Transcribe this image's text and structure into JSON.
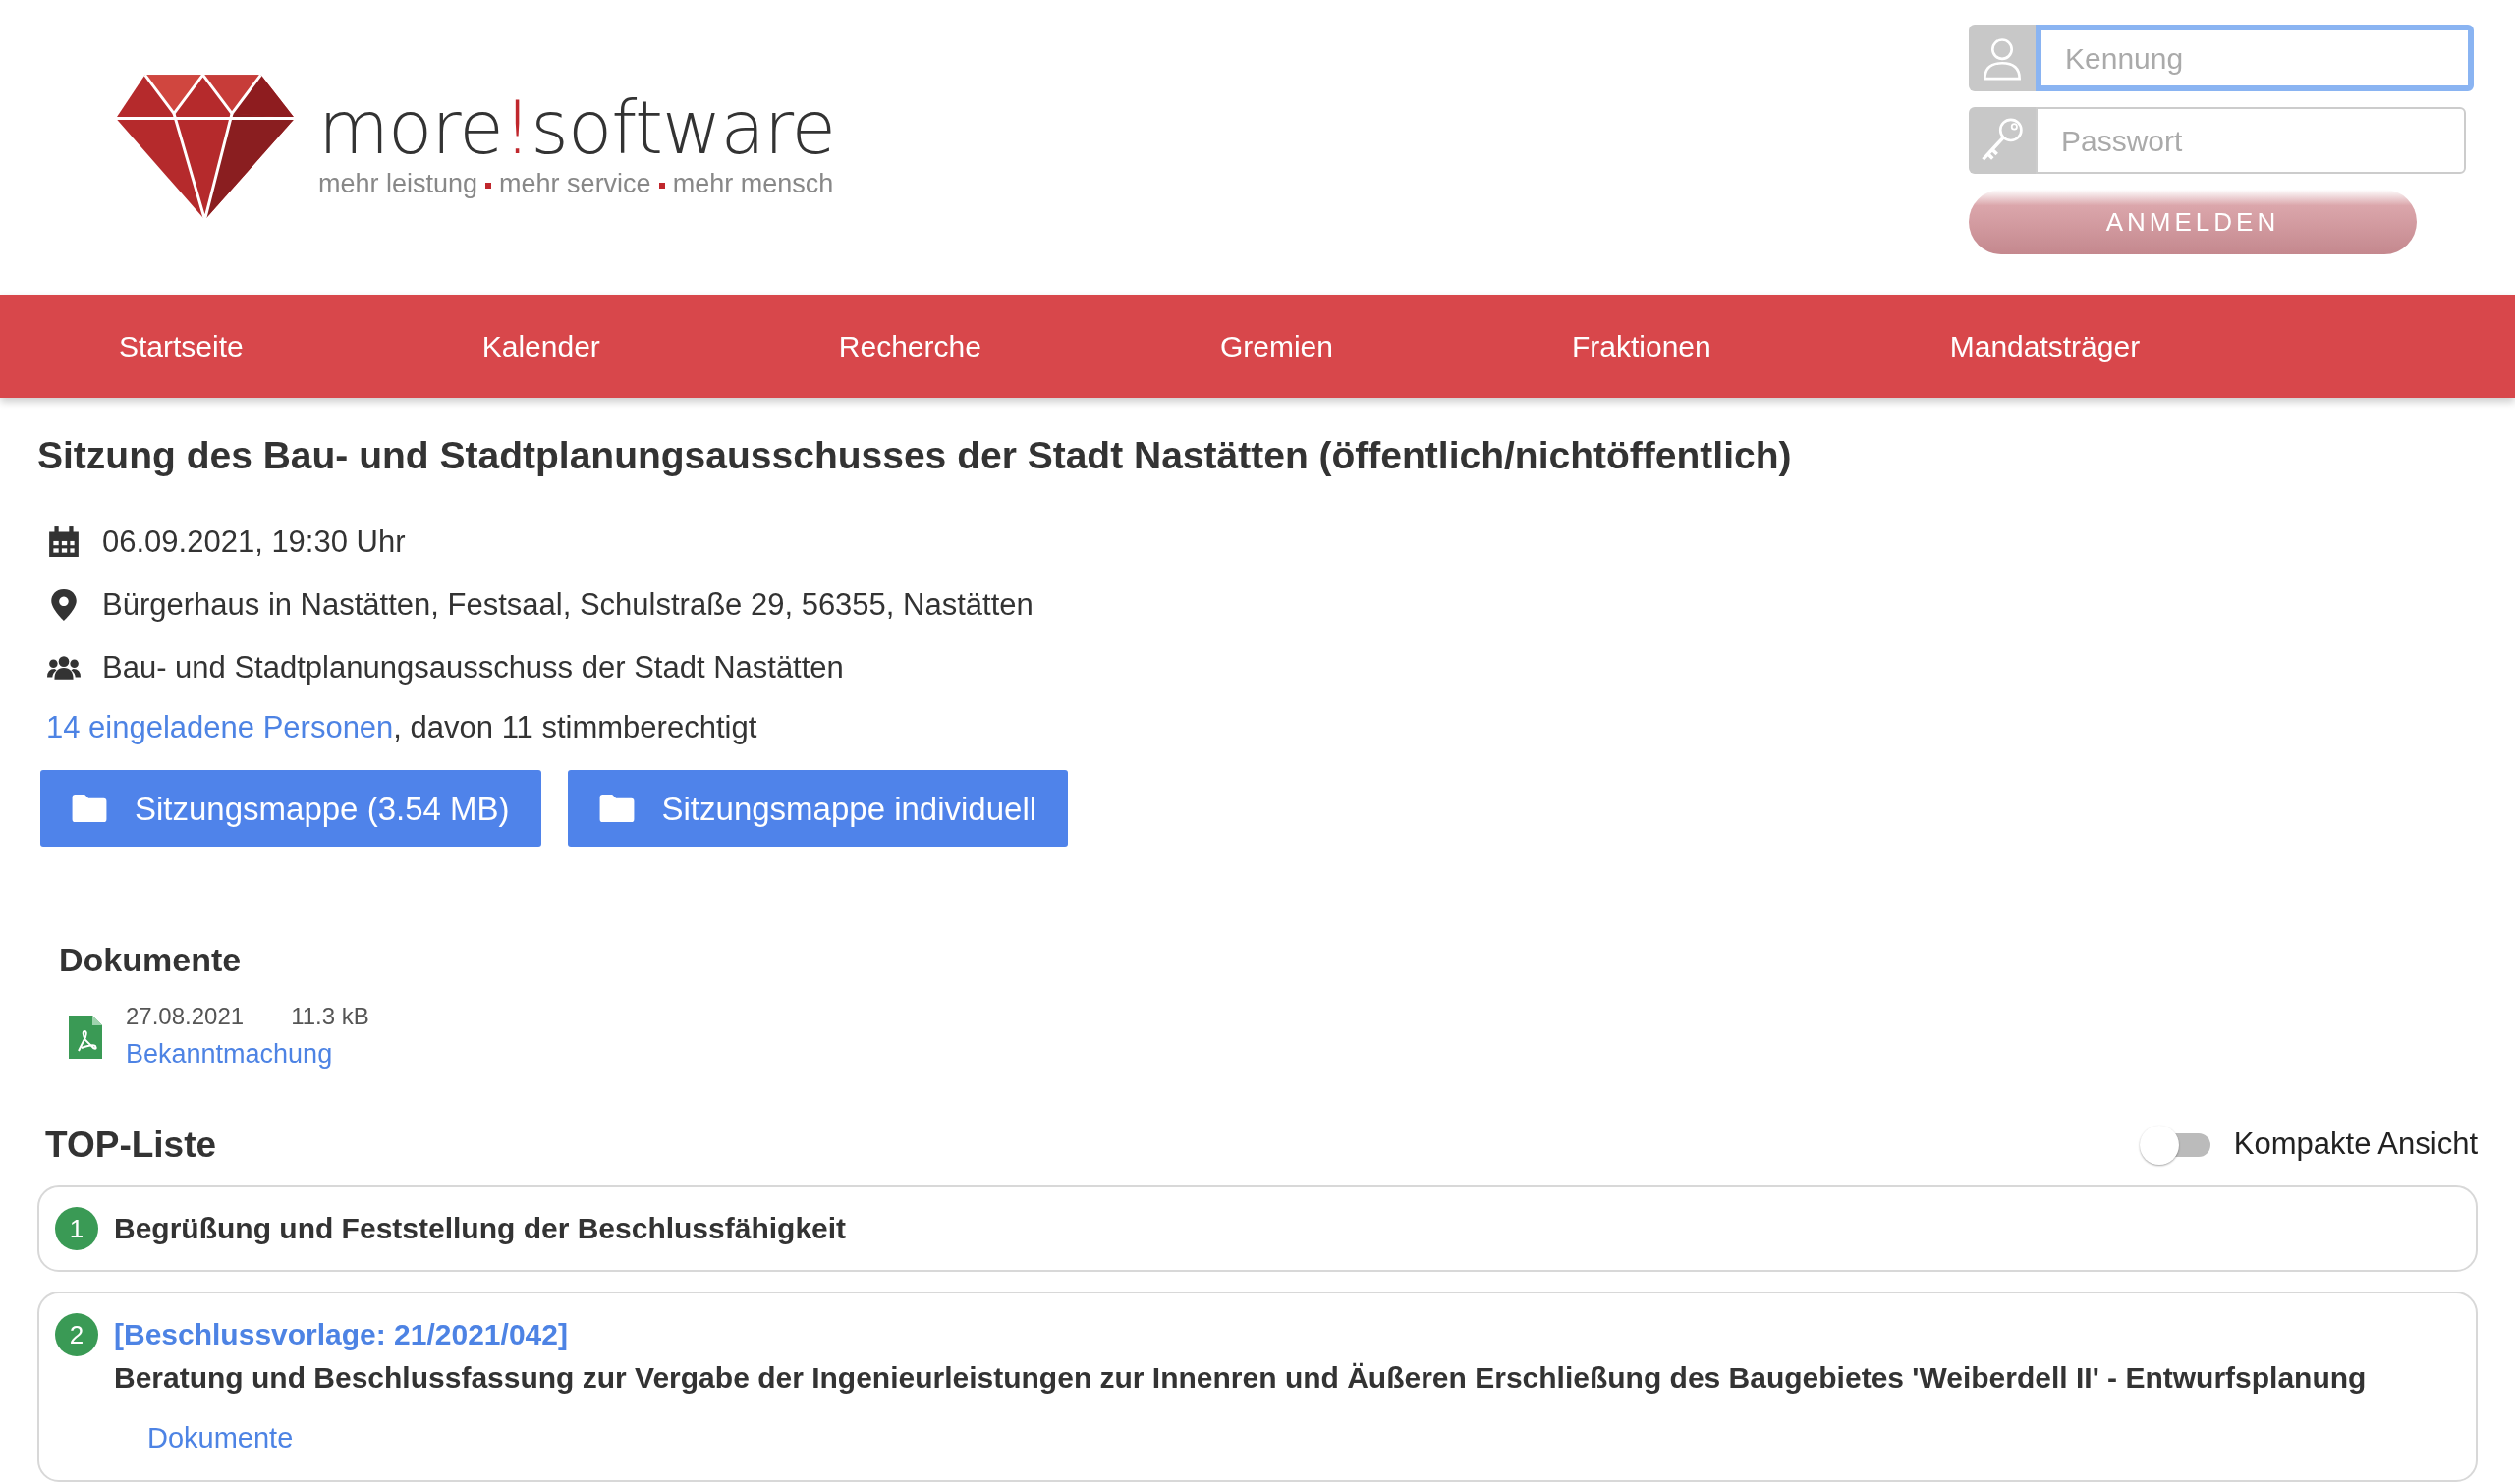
{
  "header": {
    "logo": {
      "name_left": "more",
      "exclamation": "!",
      "name_right": "software",
      "tagline": [
        "mehr leistung",
        "mehr service",
        "mehr mensch"
      ]
    },
    "login": {
      "username": {
        "placeholder": "Kennung",
        "focused": true
      },
      "password": {
        "placeholder": "Passwort",
        "focused": false
      },
      "submit": "ANMELDEN"
    }
  },
  "nav": [
    "Startseite",
    "Kalender",
    "Recherche",
    "Gremien",
    "Fraktionen",
    "Mandatsträger"
  ],
  "meeting": {
    "title": "Sitzung des Bau- und Stadtplanungsausschusses der Stadt Nastätten (öffentlich/nichtöffentlich)",
    "details": [
      {
        "kind": "date",
        "text": "06.09.2021, 19:30 Uhr"
      },
      {
        "kind": "location",
        "text": "Bürgerhaus in Nastätten, Festsaal, Schulstraße 29, 56355, Nastätten"
      },
      {
        "kind": "committee",
        "text": "Bau- und Stadtplanungsausschuss der Stadt Nastätten"
      }
    ],
    "invited_link": "14 eingeladene Personen",
    "invited_rest": ", davon 11 stimmberechtigt",
    "buttons": [
      "Sitzungsmappe (3.54 MB)",
      "Sitzungsmappe individuell"
    ]
  },
  "documents": {
    "heading": "Dokumente",
    "items": [
      {
        "date": "27.08.2021",
        "size": "11.3 kB",
        "name": "Bekanntmachung"
      }
    ]
  },
  "agenda": {
    "heading": "TOP-Liste",
    "compact_toggle": {
      "label": "Kompakte Ansicht",
      "on": false
    },
    "items": [
      {
        "number": "1",
        "title": "Begrüßung und Feststellung der Beschlussfähigkeit"
      },
      {
        "number": "2",
        "reference": "[Beschlussvorlage: 21/2021/042]",
        "title": "Beratung und Beschlussfassung zur Vergabe der Ingenieurleistungen zur Innenren und Äußeren Erschließung des Baugebietes 'Weiberdell II' - Entwurfsplanung",
        "documents_link": "Dokumente"
      }
    ]
  }
}
